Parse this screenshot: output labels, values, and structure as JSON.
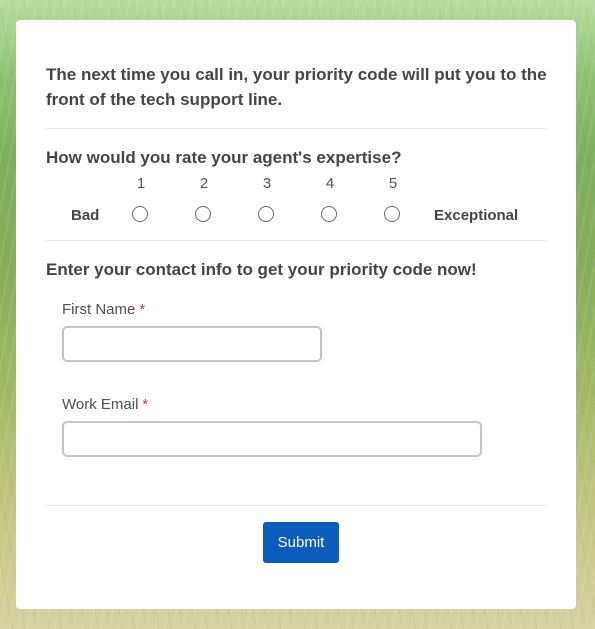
{
  "form": {
    "intro": "The next time you call in, your priority code will put you to the front of the tech support line.",
    "rating": {
      "question": "How would you rate your agent's expertise?",
      "scale": [
        "1",
        "2",
        "3",
        "4",
        "5"
      ],
      "low_label": "Bad",
      "high_label": "Exceptional"
    },
    "contact": {
      "heading": "Enter your contact info to get your priority code now!",
      "first_name_label": "First Name",
      "first_name_value": "",
      "work_email_label": "Work Email",
      "work_email_value": "",
      "required_marker": "*"
    },
    "submit_label": "Submit"
  },
  "colors": {
    "accent": "#0b5cbb",
    "required": "#c0392b",
    "text": "#454545"
  }
}
